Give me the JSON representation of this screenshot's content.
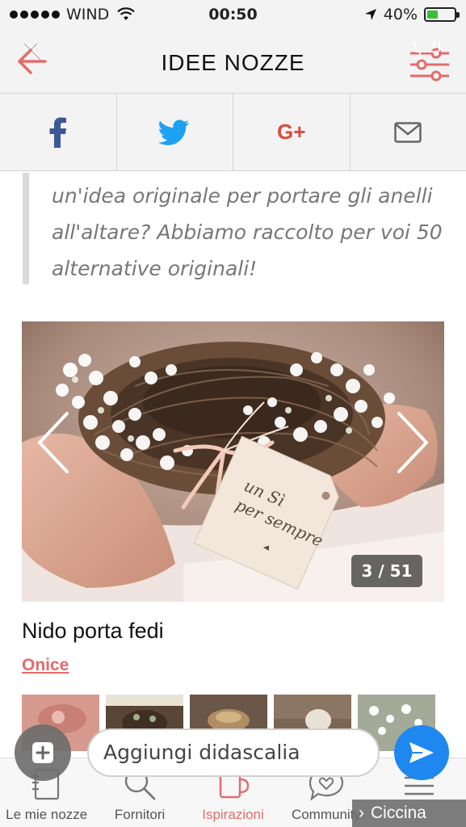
{
  "status_bar": {
    "carrier": "WIND",
    "time": "00:50",
    "battery_percent": "40%",
    "battery_level": 0.4
  },
  "header": {
    "title": "IDEE NOZZE",
    "back_icon": "back-arrow-icon",
    "filter_icon": "filter-sliders-icon"
  },
  "share": {
    "items": [
      "facebook-icon",
      "twitter-icon",
      "google-plus-icon",
      "mail-icon"
    ],
    "google_plus_label": "G+"
  },
  "quote": {
    "text": "un'idea originale per portare gli anelli all'altare? Abbiamo raccolto per voi 50 alternative originali!"
  },
  "gallery": {
    "counter": "3 / 51",
    "current": 3,
    "total": 51,
    "tag_text": "un Sì per sempre",
    "title": "Nido porta fedi",
    "author": "Onice"
  },
  "composer": {
    "placeholder": "Aggiungi didascalia"
  },
  "tabbar": {
    "tabs": [
      {
        "label": "Le mie nozze",
        "icon": "notebook-icon"
      },
      {
        "label": "Fornitori",
        "icon": "search-icon"
      },
      {
        "label": "Ispirazioni",
        "icon": "mug-icon",
        "active": true
      },
      {
        "label": "Community",
        "icon": "chat-heart-icon"
      },
      {
        "label": "Ciccina",
        "icon": "menu-icon"
      }
    ]
  },
  "user_pill": {
    "name": "Ciccina"
  },
  "colors": {
    "accent": "#e46b6b",
    "facebook": "#3b5998",
    "twitter": "#1da1f2",
    "google_plus": "#dd4b39",
    "send_button": "#1e88f0"
  }
}
